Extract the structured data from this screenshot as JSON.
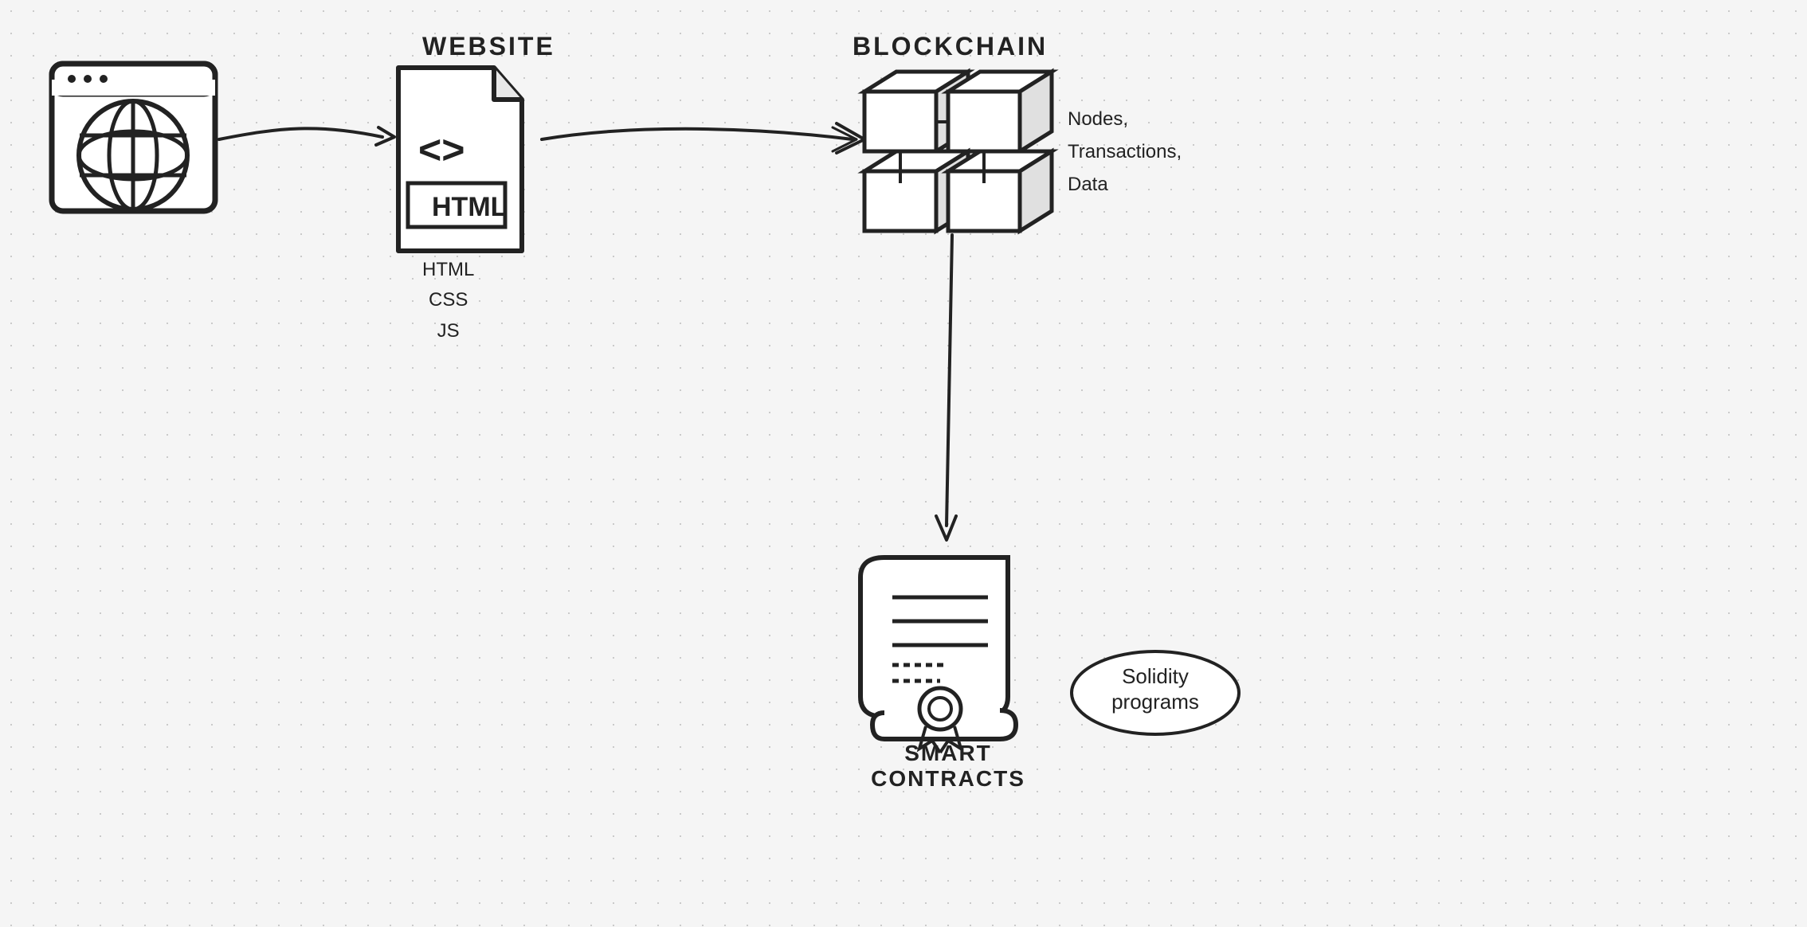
{
  "diagram": {
    "website_label": "WEBSITE",
    "blockchain_label": "BLOCKCHAIN",
    "html_css_js": "HTML\nCSS\nJS",
    "blockchain_desc": "Nodes,\nTransactions,\nData",
    "smart_contracts_label": "SMART\nCONTRACTS",
    "solidity_programs": "Solidity\nprograms"
  }
}
